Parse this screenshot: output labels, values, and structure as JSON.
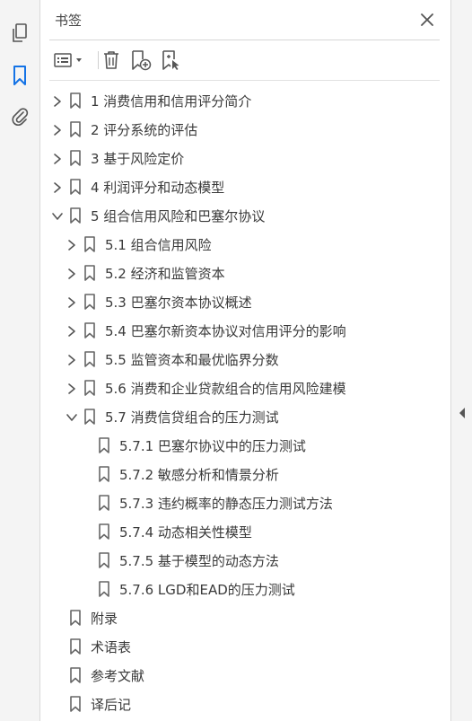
{
  "panel": {
    "title": "书签",
    "close_icon": "close-icon"
  },
  "rail": {
    "icons": [
      "pages-icon",
      "bookmark-icon",
      "attachment-icon"
    ],
    "accent": "#1473e6"
  },
  "toolbar": {
    "icons": [
      "options-menu-icon",
      "delete-icon",
      "new-bookmark-icon",
      "new-bookmark-from-structure-icon"
    ]
  },
  "bookmarks": [
    {
      "label": "1 消费信用和信用评分简介",
      "level": 0,
      "chevron": "right"
    },
    {
      "label": "2 评分系统的评估",
      "level": 0,
      "chevron": "right"
    },
    {
      "label": "3 基于风险定价",
      "level": 0,
      "chevron": "right"
    },
    {
      "label": "4 利润评分和动态模型",
      "level": 0,
      "chevron": "right"
    },
    {
      "label": "5 组合信用风险和巴塞尔协议",
      "level": 0,
      "chevron": "down"
    },
    {
      "label": "5.1 组合信用风险",
      "level": 1,
      "chevron": "right"
    },
    {
      "label": "5.2 经济和监管资本",
      "level": 1,
      "chevron": "right"
    },
    {
      "label": "5.3 巴塞尔资本协议概述",
      "level": 1,
      "chevron": "right"
    },
    {
      "label": "5.4 巴塞尔新资本协议对信用评分的影响",
      "level": 1,
      "chevron": "right"
    },
    {
      "label": "5.5 监管资本和最优临界分数",
      "level": 1,
      "chevron": "right"
    },
    {
      "label": "5.6 消费和企业贷款组合的信用风险建模",
      "level": 1,
      "chevron": "right"
    },
    {
      "label": "5.7 消费信贷组合的压力测试",
      "level": 1,
      "chevron": "down"
    },
    {
      "label": "5.7.1 巴塞尔协议中的压力测试",
      "level": 2,
      "chevron": "none"
    },
    {
      "label": "5.7.2 敏感分析和情景分析",
      "level": 2,
      "chevron": "none"
    },
    {
      "label": "5.7.3 违约概率的静态压力测试方法",
      "level": 2,
      "chevron": "none"
    },
    {
      "label": "5.7.4 动态相关性模型",
      "level": 2,
      "chevron": "none"
    },
    {
      "label": "5.7.5 基于模型的动态方法",
      "level": 2,
      "chevron": "none"
    },
    {
      "label": "5.7.6 LGD和EAD的压力测试",
      "level": 2,
      "chevron": "none"
    },
    {
      "label": "附录",
      "level": 0,
      "chevron": "none"
    },
    {
      "label": "术语表",
      "level": 0,
      "chevron": "none"
    },
    {
      "label": "参考文献",
      "level": 0,
      "chevron": "none"
    },
    {
      "label": "译后记",
      "level": 0,
      "chevron": "none"
    }
  ]
}
